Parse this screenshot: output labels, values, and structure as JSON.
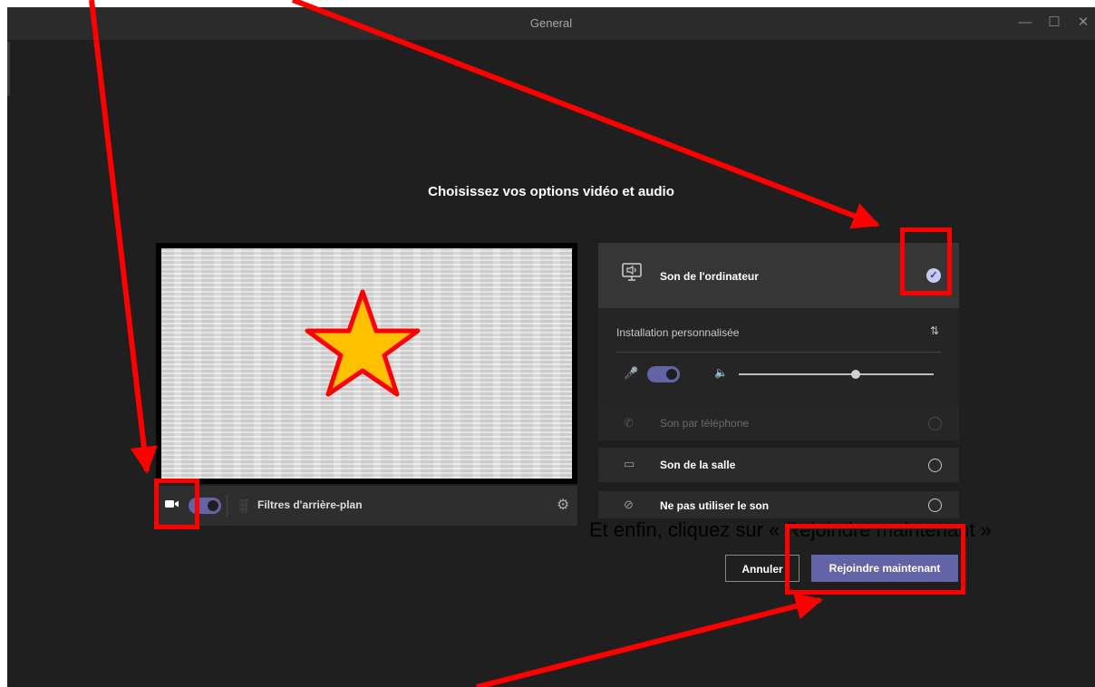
{
  "window": {
    "title": "General",
    "controls": [
      "minimize-icon",
      "maximize-icon",
      "close-icon"
    ]
  },
  "heading": "Choisissez vos options vidéo et audio",
  "video_bar": {
    "filters_label": "Filtres d'arrière-plan",
    "camera_on": true
  },
  "audio_options": {
    "computer_audio": {
      "label": "Son de l'ordinateur",
      "selected": true
    },
    "custom_setup": "Installation personnalisée",
    "mic_on": true,
    "speaker_volume": 0.6,
    "phone_audio": {
      "label": "Son par téléphone",
      "disabled": true
    },
    "room_audio": {
      "label": "Son de la salle"
    },
    "no_audio": {
      "label": "Ne pas utiliser le son"
    }
  },
  "buttons": {
    "cancel": "Annuler",
    "join": "Rejoindre maintenant"
  },
  "annotation_text": "Et enfin, cliquez sur « Rejoindre maintenant »",
  "colors": {
    "accent": "#6264a7",
    "annotation": "#ff0000",
    "star_fill": "#ffc000"
  }
}
